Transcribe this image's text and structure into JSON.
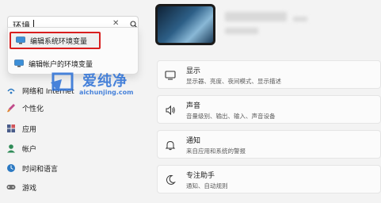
{
  "search": {
    "value": "环境",
    "clear_glyph": "✕"
  },
  "dropdown": {
    "items": [
      {
        "label": "编辑系统环境变量",
        "icon": "system-properties-icon",
        "highlighted": true
      },
      {
        "label": "编辑帐户的环境变量",
        "icon": "system-properties-icon",
        "highlighted": false
      }
    ]
  },
  "nav": {
    "items": [
      {
        "label": "网络和 Internet",
        "icon": "network-icon"
      },
      {
        "label": "个性化",
        "icon": "personalization-brush-icon"
      },
      {
        "label": "应用",
        "icon": "apps-icon"
      },
      {
        "label": "帐户",
        "icon": "account-icon"
      },
      {
        "label": "时间和语言",
        "icon": "time-language-icon"
      },
      {
        "label": "游戏",
        "icon": "gaming-controller-icon"
      }
    ]
  },
  "watermark": {
    "text_cn": "爱纯净",
    "text_en": "aichunjing.com"
  },
  "settings": {
    "items": [
      {
        "title": "显示",
        "subtitle": "显示器、亮度、夜间模式、显示描述",
        "icon": "display-icon"
      },
      {
        "title": "声音",
        "subtitle": "音量级别、输出、输入、声音设备",
        "icon": "sound-icon"
      },
      {
        "title": "通知",
        "subtitle": "来自应用和系统的警报",
        "icon": "notification-bell-icon"
      },
      {
        "title": "专注助手",
        "subtitle": "通知、自动规则",
        "icon": "focus-assist-moon-icon"
      }
    ]
  },
  "colors": {
    "accent": "#0067c0",
    "highlight_border": "#d81e1e",
    "watermark_blue": "#2a6fd6",
    "background": "#f3f3f3"
  }
}
